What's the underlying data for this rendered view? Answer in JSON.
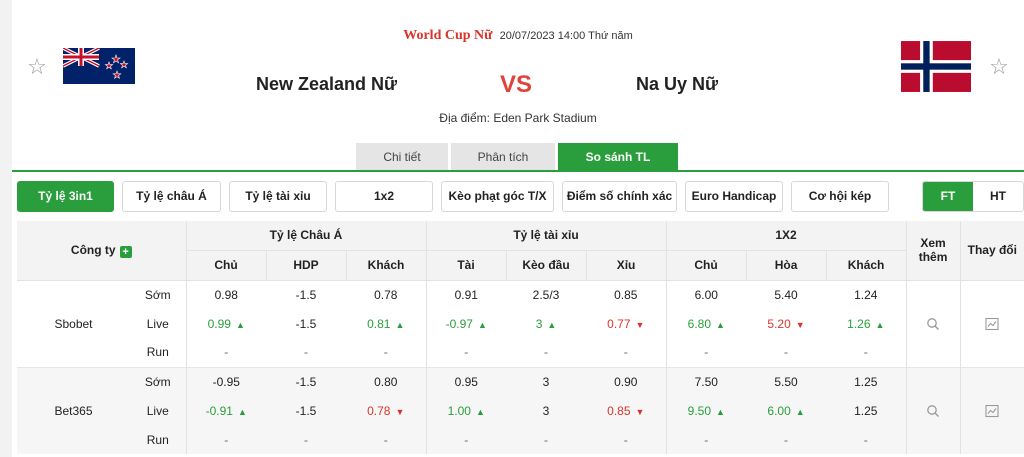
{
  "header": {
    "league": "World Cup Nữ",
    "datetime": "20/07/2023 14:00 Thứ năm",
    "home_team": "New Zealand Nữ",
    "away_team": "Na Uy Nữ",
    "vs_label": "VS",
    "venue": "Địa điểm: Eden Park Stadium"
  },
  "tabs": [
    {
      "label": "Chi tiết",
      "active": false
    },
    {
      "label": "Phân tích",
      "active": false
    },
    {
      "label": "So sánh TL",
      "active": true
    }
  ],
  "odds_types": [
    "Tỷ lệ 3in1",
    "Tỷ lệ châu Á",
    "Tỷ lệ tài xỉu",
    "1x2",
    "Kèo phạt góc T/X",
    "Điểm số chính xác",
    "Euro Handicap",
    "Cơ hội kép"
  ],
  "period": {
    "ft": "FT",
    "ht": "HT",
    "active": "FT"
  },
  "table": {
    "company_header": "Công ty",
    "groups": [
      "Tỷ lệ Châu Á",
      "Tỷ lệ tài xỉu",
      "1X2"
    ],
    "view_more": "Xem thêm",
    "changes": "Thay đổi",
    "sub_headers": [
      "Chủ",
      "HDP",
      "Khách",
      "Tài",
      "Kèo đầu",
      "Xỉu",
      "Chủ",
      "Hòa",
      "Khách"
    ],
    "bookmakers": [
      {
        "name": "Sbobet",
        "rows": [
          {
            "label": "Sớm",
            "values": [
              "0.98",
              "-1.5",
              "0.78",
              "0.91",
              "2.5/3",
              "0.85",
              "6.00",
              "5.40",
              "1.24"
            ],
            "trend": [
              "",
              "",
              "",
              "",
              "",
              "",
              "",
              "",
              ""
            ]
          },
          {
            "label": "Live",
            "values": [
              "0.99",
              "-1.5",
              "0.81",
              "-0.97",
              "3",
              "0.77",
              "6.80",
              "5.20",
              "1.26"
            ],
            "trend": [
              "up",
              "",
              "up",
              "up",
              "up",
              "down",
              "up",
              "down",
              "up"
            ]
          },
          {
            "label": "Run",
            "values": [
              "-",
              "-",
              "-",
              "-",
              "-",
              "-",
              "-",
              "-",
              "-"
            ],
            "trend": [
              "",
              "",
              "",
              "",
              "",
              "",
              "",
              "",
              ""
            ]
          }
        ]
      },
      {
        "name": "Bet365",
        "rows": [
          {
            "label": "Sớm",
            "values": [
              "-0.95",
              "-1.5",
              "0.80",
              "0.95",
              "3",
              "0.90",
              "7.50",
              "5.50",
              "1.25"
            ],
            "trend": [
              "",
              "",
              "",
              "",
              "",
              "",
              "",
              "",
              ""
            ]
          },
          {
            "label": "Live",
            "values": [
              "-0.91",
              "-1.5",
              "0.78",
              "1.00",
              "3",
              "0.85",
              "9.50",
              "6.00",
              "1.25"
            ],
            "trend": [
              "up",
              "",
              "down",
              "up",
              "",
              "down",
              "up",
              "up",
              ""
            ]
          },
          {
            "label": "Run",
            "values": [
              "-",
              "-",
              "-",
              "-",
              "-",
              "-",
              "-",
              "-",
              "-"
            ],
            "trend": [
              "",
              "",
              "",
              "",
              "",
              "",
              "",
              "",
              ""
            ]
          }
        ]
      }
    ]
  },
  "colors": {
    "accent_green": "#2a9e3c",
    "red": "#d9342b"
  },
  "icons": [
    "star-icon",
    "plus-icon",
    "search-icon",
    "chart-icon",
    "arrow-up-icon",
    "arrow-down-icon"
  ]
}
